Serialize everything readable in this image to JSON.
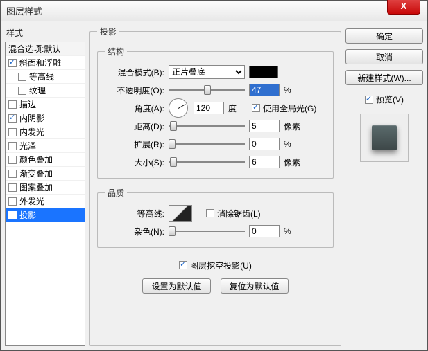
{
  "window": {
    "title": "图层样式"
  },
  "sidebar": {
    "header": "样式",
    "items": [
      {
        "label": "混合选项:默认",
        "checked": false,
        "header": true
      },
      {
        "label": "斜面和浮雕",
        "checked": true
      },
      {
        "label": "等高线",
        "checked": false,
        "indent": true
      },
      {
        "label": "纹理",
        "checked": false,
        "indent": true
      },
      {
        "label": "描边",
        "checked": false
      },
      {
        "label": "内阴影",
        "checked": true
      },
      {
        "label": "内发光",
        "checked": false
      },
      {
        "label": "光泽",
        "checked": false
      },
      {
        "label": "颜色叠加",
        "checked": false
      },
      {
        "label": "渐变叠加",
        "checked": false
      },
      {
        "label": "图案叠加",
        "checked": false
      },
      {
        "label": "外发光",
        "checked": false
      },
      {
        "label": "投影",
        "checked": true,
        "selected": true
      }
    ]
  },
  "main": {
    "title": "投影",
    "structure": {
      "title": "结构",
      "blend_mode_label": "混合模式(B):",
      "blend_mode_value": "正片叠底",
      "opacity_label": "不透明度(O):",
      "opacity_value": "47",
      "opacity_unit": "%",
      "angle_label": "角度(A):",
      "angle_value": "120",
      "angle_unit": "度",
      "global_light_label": "使用全局光(G)",
      "global_light_checked": true,
      "distance_label": "距离(D):",
      "distance_value": "5",
      "distance_unit": "像素",
      "spread_label": "扩展(R):",
      "spread_value": "0",
      "spread_unit": "%",
      "size_label": "大小(S):",
      "size_value": "6",
      "size_unit": "像素"
    },
    "quality": {
      "title": "品质",
      "contour_label": "等高线:",
      "antialias_label": "消除锯齿(L)",
      "antialias_checked": false,
      "noise_label": "杂色(N):",
      "noise_value": "0",
      "noise_unit": "%"
    },
    "knockout_label": "图层挖空投影(U)",
    "knockout_checked": true,
    "set_default_label": "设置为默认值",
    "reset_default_label": "复位为默认值"
  },
  "right": {
    "ok": "确定",
    "cancel": "取消",
    "new_style": "新建样式(W)...",
    "preview_label": "预览(V)",
    "preview_checked": true
  }
}
